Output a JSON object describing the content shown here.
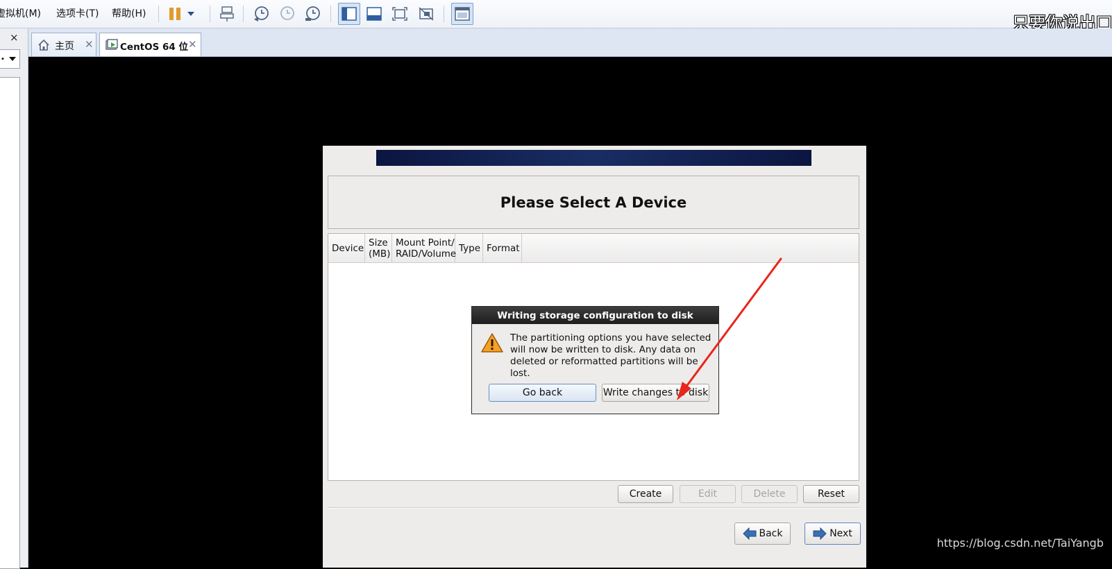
{
  "menu": {
    "vm": "虚拟机(M)",
    "tabs": "选项卡(T)",
    "help": "帮助(H)"
  },
  "watermark_top": "只要你说出口",
  "tabs": [
    {
      "label": "主页",
      "icon": "home-icon"
    },
    {
      "label": "CentOS 64 位",
      "icon": "vm-icon"
    }
  ],
  "left_panel": {
    "close_glyph": "×"
  },
  "installer": {
    "title": "Please Select A Device",
    "columns": [
      {
        "line1": "Device",
        "line2": ""
      },
      {
        "line1": "Size",
        "line2": "(MB)"
      },
      {
        "line1": "Mount Point/",
        "line2": "RAID/Volume"
      },
      {
        "line1": "Type",
        "line2": ""
      },
      {
        "line1": "Format",
        "line2": ""
      }
    ],
    "buttons": {
      "create": "Create",
      "edit": "Edit",
      "delete": "Delete",
      "reset": "Reset",
      "back": "Back",
      "next": "Next"
    }
  },
  "dialog": {
    "title": "Writing storage configuration to disk",
    "message": "The partitioning options you have selected\nwill now be written to disk.  Any data on\ndeleted or reformatted partitions will be lost.",
    "go_back": "Go back",
    "write": "Write changes to disk",
    "icon": "warning-icon"
  },
  "watermark_bottom": "https://blog.csdn.net/TaiYangb",
  "colors": {
    "annotation": "#e8261c",
    "dialog_titlebar": "#2b2b2b",
    "banner": "#14245a"
  }
}
